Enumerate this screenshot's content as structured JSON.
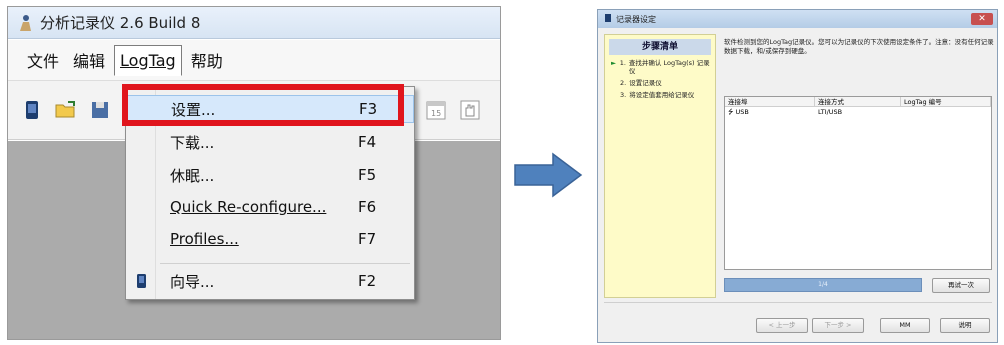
{
  "main_window": {
    "title": "分析记录仪 2.6 Build 8",
    "menu": [
      "文件",
      "编辑",
      "LogTag",
      "帮助"
    ],
    "dropdown": [
      {
        "label": "设置...",
        "key": "F3",
        "highlighted": true
      },
      {
        "label": "下载...",
        "key": "F4"
      },
      {
        "label": "休眠...",
        "key": "F5"
      },
      {
        "label": "Quick Re-configure...",
        "key": "F6"
      },
      {
        "label": "Profiles...",
        "key": "F7"
      },
      {
        "label": "向导...",
        "key": "F2",
        "icon": "logtag-device-icon"
      }
    ],
    "toolbar_icons": [
      "logtag-device-icon",
      "open-folder-icon",
      "save-icon",
      "calendar-icon",
      "hand-icon"
    ]
  },
  "wizard": {
    "title": "记录器设定",
    "steps_header": "步骤清单",
    "steps": [
      {
        "num": "1.",
        "text": "查找并确认 LogTag(s) 记录仪",
        "current": true
      },
      {
        "num": "2.",
        "text": "设置记录仪"
      },
      {
        "num": "3.",
        "text": "将设定值套用给记录仪"
      }
    ],
    "description": "软件检测到您的LogTag记录仪。您可以为记录仪的下次使用设定条件了。注意：没有任何记录数据下载，和/或保存到硬盘。",
    "table": {
      "headers": [
        "连接埠",
        "连接方式",
        "LogTag 编号"
      ],
      "rows": [
        [
          "USB",
          "LTI/USB",
          ""
        ]
      ]
    },
    "progress_text": "1/4",
    "buttons": {
      "retry": "再试一次",
      "back": "< 上一步",
      "next": "下一步 >",
      "mm": "MM",
      "help": "说明"
    }
  },
  "colors": {
    "highlight_box": "#e0151d",
    "arrow": "#4f81bd"
  }
}
